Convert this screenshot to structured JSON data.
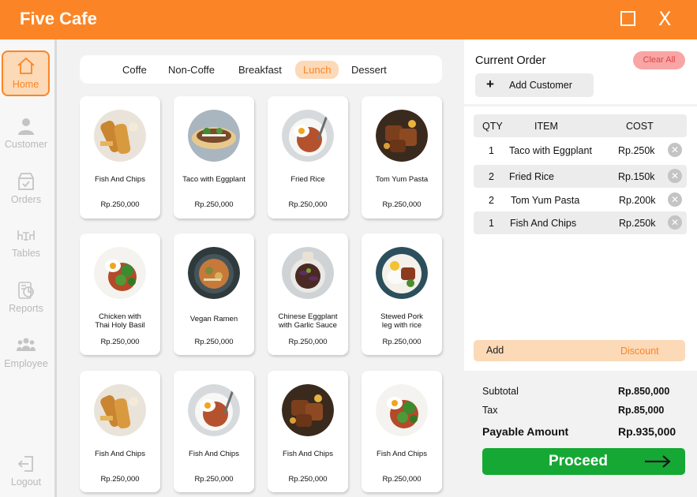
{
  "app": {
    "title": "Five Cafe"
  },
  "sidebar": {
    "items": [
      {
        "label": "Home",
        "icon": "home-icon",
        "active": true
      },
      {
        "label": "Customer",
        "icon": "user-icon"
      },
      {
        "label": "Orders",
        "icon": "orders-icon"
      },
      {
        "label": "Tables",
        "icon": "tables-icon"
      },
      {
        "label": "Reports",
        "icon": "reports-icon"
      },
      {
        "label": "Employee",
        "icon": "employee-icon"
      },
      {
        "label": "Logout",
        "icon": "logout-icon"
      }
    ]
  },
  "menu": {
    "tabs": [
      "Coffe",
      "Non-Coffe",
      "Breakfast",
      "Lunch",
      "Dessert"
    ],
    "active_tab": "Lunch",
    "items": [
      {
        "name": "Fish And Chips",
        "price": "Rp.250,000"
      },
      {
        "name": "Taco with Eggplant",
        "price": "Rp.250,000"
      },
      {
        "name": "Fried Rice",
        "price": "Rp.250,000"
      },
      {
        "name": "Tom Yum Pasta",
        "price": "Rp.250,000"
      },
      {
        "name": "Chicken with\nThai Holy Basil",
        "price": "Rp.250,000"
      },
      {
        "name": "Vegan Ramen",
        "price": "Rp.250,000"
      },
      {
        "name": "Chinese Eggplant\nwith Garlic Sauce",
        "price": "Rp.250,000"
      },
      {
        "name": "Stewed Pork\nleg with rice",
        "price": "Rp.250,000"
      },
      {
        "name": "Fish And Chips",
        "price": "Rp.250,000"
      },
      {
        "name": "Fish And Chips",
        "price": "Rp.250,000"
      },
      {
        "name": "Fish And Chips",
        "price": "Rp.250,000"
      },
      {
        "name": "Fish And Chips",
        "price": "Rp.250,000"
      }
    ]
  },
  "order": {
    "title": "Current Order",
    "clear_label": "Clear All",
    "add_customer_label": "Add Customer",
    "columns": {
      "qty": "QTY",
      "item": "ITEM",
      "cost": "COST"
    },
    "rows": [
      {
        "qty": "1",
        "item": "Taco with Eggplant",
        "cost": "Rp.250k"
      },
      {
        "qty": "2",
        "item": "Fried Rice",
        "cost": "Rp.150k"
      },
      {
        "qty": "2",
        "item": "Tom Yum Pasta",
        "cost": "Rp.200k"
      },
      {
        "qty": "1",
        "item": "Fish And Chips",
        "cost": "Rp.250k"
      }
    ],
    "add_label": "Add",
    "discount_label": "Discount"
  },
  "summary": {
    "subtotal_label": "Subtotal",
    "subtotal": "Rp.850,000",
    "tax_label": "Tax",
    "tax": "Rp.85,000",
    "payable_label": "Payable Amount",
    "payable": "Rp.935,000",
    "proceed_label": "Proceed"
  },
  "colors": {
    "accent": "#fb8526",
    "accent_light": "#fcd9b7",
    "proceed": "#16a834",
    "clear": "#f8a5a5"
  }
}
